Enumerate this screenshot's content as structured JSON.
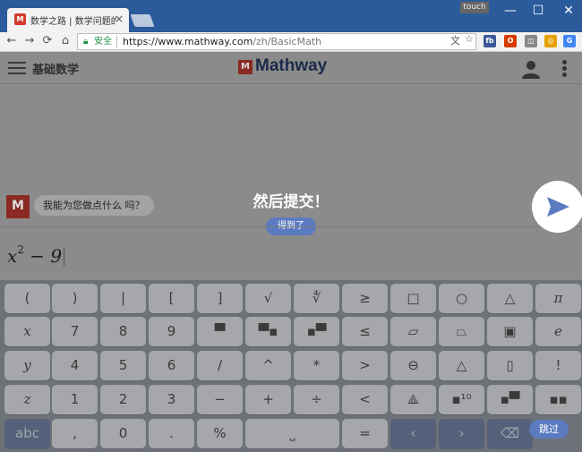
{
  "browser": {
    "tab_title": "数学之路 | 数学问题的解",
    "tab_favicon": "M",
    "tab_close": "×",
    "touch_badge": "touch",
    "min_label": "—",
    "max_label": "☐",
    "close_label": "✕",
    "back_icon": "←",
    "forward_icon": "→",
    "reload_icon": "⟳",
    "home_icon": "⌂",
    "secure_label": "安全",
    "url_base": "https://www.mathway.com",
    "url_path": "/zh/BasicMath",
    "translate_icon": "文",
    "star_icon": "☆",
    "extensions": [
      {
        "label": "fb",
        "color": "#3b5998"
      },
      {
        "label": "O",
        "color": "#d83b01"
      },
      {
        "label": "◫",
        "color": "#888888"
      },
      {
        "label": "◎",
        "color": "#e6a100"
      },
      {
        "label": "G",
        "color": "#4285f4"
      }
    ]
  },
  "app": {
    "subject": "基础数学",
    "logo_text": "Mathway",
    "logo_mark": "M",
    "avatar_mark": "M",
    "chat_prompt": "我能为您做点什么 吗？",
    "coach_title": "然后提交！",
    "coach_button": "得到了",
    "expression_base": "x",
    "expression_exp": "2",
    "expression_rest": " − 9",
    "skip_label": "跳过"
  },
  "keypad": {
    "rows": [
      [
        "(",
        ")",
        "|",
        "[",
        "]",
        "√",
        "∜",
        "≥",
        "□",
        "○",
        "△",
        "π"
      ],
      [
        "x",
        "7",
        "8",
        "9",
        "▀",
        "▀▪",
        "▪▀",
        "≤",
        "▱",
        "⏢",
        "▣",
        "e"
      ],
      [
        "y",
        "4",
        "5",
        "6",
        "/",
        "^",
        "*",
        ">",
        "⊖",
        "△",
        "▯",
        "!"
      ],
      [
        "z",
        "1",
        "2",
        "3",
        "−",
        "+",
        "÷",
        "<",
        "⟁",
        "▪¹⁰",
        "▪▀",
        "▪▪"
      ],
      [
        "abc",
        ",",
        "0",
        ".",
        "%",
        "⎵",
        "=",
        "‹",
        "›",
        "⌫"
      ]
    ]
  },
  "colors": {
    "brand_blue": "#5b7bc0",
    "logo_red": "#8a2a22",
    "overlay_gray": "#8b8b8b"
  }
}
